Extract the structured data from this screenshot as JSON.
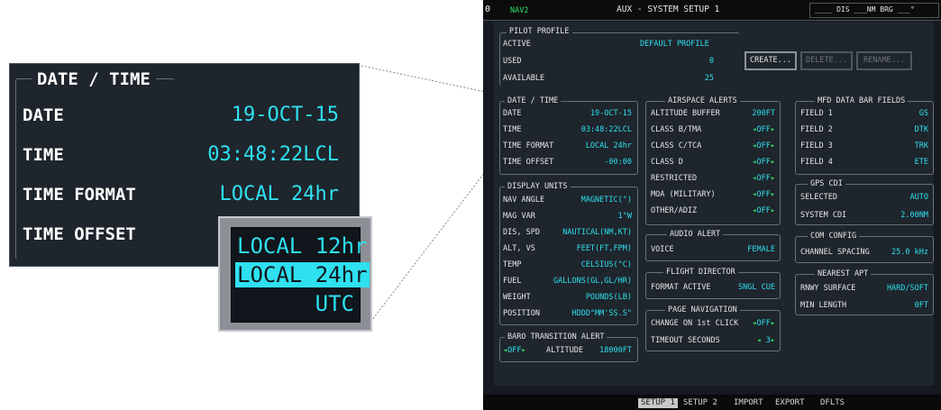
{
  "zoom": {
    "title": "DATE / TIME",
    "rows": [
      {
        "label": "DATE",
        "value": "19-OCT-15"
      },
      {
        "label": "TIME",
        "value": "03:48:22LCL"
      },
      {
        "label": "TIME FORMAT",
        "value": "LOCAL 24hr"
      },
      {
        "label": "TIME OFFSET",
        "value": ""
      }
    ],
    "popup_options": [
      "LOCAL 12hr",
      "LOCAL 24hr",
      "UTC"
    ],
    "popup_selected": 1
  },
  "top": {
    "left": "0",
    "nav": "NAV2",
    "title": "AUX - SYSTEM SETUP 1",
    "right": "____ DIS ___NM BRG ___°"
  },
  "pilot_profile": {
    "title": "PILOT PROFILE",
    "active_label": "ACTIVE",
    "active_value": "DEFAULT PROFILE",
    "used_label": "USED",
    "used_value": "0",
    "available_label": "AVAILABLE",
    "available_value": "25",
    "create": "CREATE...",
    "delete": "DELETE...",
    "rename": "RENAME..."
  },
  "date_time": {
    "title": "DATE / TIME",
    "rows": [
      {
        "label": "DATE",
        "value": "19-OCT-15"
      },
      {
        "label": "TIME",
        "value": "03:48:22LCL"
      },
      {
        "label": "TIME FORMAT",
        "value": "LOCAL 24hr"
      },
      {
        "label": "TIME OFFSET",
        "value": "-00:00"
      }
    ]
  },
  "display_units": {
    "title": "DISPLAY UNITS",
    "rows": [
      {
        "label": "NAV ANGLE",
        "value": "MAGNETIC(°)"
      },
      {
        "label": "MAG VAR",
        "value": "1°W"
      },
      {
        "label": "DIS, SPD",
        "value": "NAUTICAL(NM,KT)"
      },
      {
        "label": "ALT, VS",
        "value": "FEET(FT,FPM)"
      },
      {
        "label": "TEMP",
        "value": "CELSIUS(°C)"
      },
      {
        "label": "FUEL",
        "value": "GALLONS(GL,GL/HR)"
      },
      {
        "label": "WEIGHT",
        "value": "POUNDS(LB)"
      },
      {
        "label": "POSITION",
        "value": "HDDD°MM'SS.S\""
      }
    ]
  },
  "baro": {
    "title": "BARO TRANSITION ALERT",
    "toggle": "OFF",
    "altitude_label": "ALTITUDE",
    "altitude_value": "18000FT"
  },
  "airspace": {
    "title": "AIRSPACE ALERTS",
    "rows": [
      {
        "label": "ALTITUDE BUFFER",
        "value": "200FT"
      },
      {
        "label": "CLASS B/TMA",
        "value": "OFF"
      },
      {
        "label": "CLASS C/TCA",
        "value": "OFF"
      },
      {
        "label": "CLASS D",
        "value": "OFF"
      },
      {
        "label": "RESTRICTED",
        "value": "OFF"
      },
      {
        "label": "MOA (MILITARY)",
        "value": "OFF"
      },
      {
        "label": "OTHER/ADIZ",
        "value": "OFF"
      }
    ]
  },
  "audio": {
    "title": "AUDIO ALERT",
    "label": "VOICE",
    "value": "FEMALE"
  },
  "flight_director": {
    "title": "FLIGHT DIRECTOR",
    "label": "FORMAT ACTIVE",
    "value": "SNGL CUE"
  },
  "page_nav": {
    "title": "PAGE NAVIGATION",
    "change_label": "CHANGE ON 1st CLICK",
    "change_value": "OFF",
    "timeout_label": "TIMEOUT SECONDS",
    "timeout_value": "3"
  },
  "mfd_fields": {
    "title": "MFD DATA BAR FIELDS",
    "rows": [
      {
        "label": "FIELD 1",
        "value": "GS"
      },
      {
        "label": "FIELD 2",
        "value": "DTK"
      },
      {
        "label": "FIELD 3",
        "value": "TRK"
      },
      {
        "label": "FIELD 4",
        "value": "ETE"
      }
    ]
  },
  "gps_cdi": {
    "title": "GPS CDI",
    "selected_label": "SELECTED",
    "selected_value": "AUTO",
    "system_label": "SYSTEM CDI",
    "system_value": "2.00NM"
  },
  "com_config": {
    "title": "COM CONFIG",
    "label": "CHANNEL SPACING",
    "value": "25.0 kHz"
  },
  "nearest_apt": {
    "title": "NEAREST APT",
    "rwy_label": "RNWY SURFACE",
    "rwy_value": "HARD/SOFT",
    "min_label": "MIN LENGTH",
    "min_value": "0FT"
  },
  "softkeys": [
    "SETUP 1",
    "SETUP 2",
    "IMPORT",
    "EXPORT",
    "DFLTS"
  ],
  "colors": {
    "cyan": "#2ee0f0",
    "green": "#2ee06a",
    "panel": "#1e252c"
  }
}
